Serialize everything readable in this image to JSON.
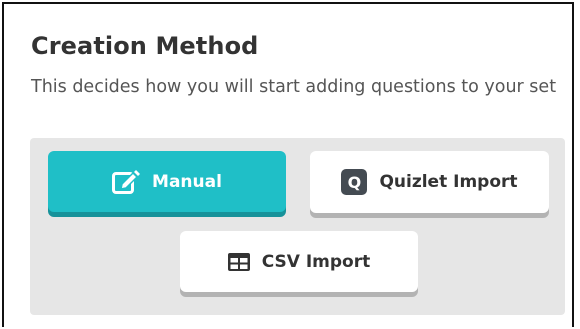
{
  "section": {
    "title": "Creation Method",
    "description": "This decides how you will start adding questions to your set"
  },
  "options": [
    {
      "label": "Manual",
      "icon": "edit-icon",
      "selected": true
    },
    {
      "label": "Quizlet Import",
      "icon": "quizlet-icon",
      "icon_text": "Q",
      "selected": false
    },
    {
      "label": "CSV Import",
      "icon": "table-icon",
      "selected": false
    }
  ],
  "colors": {
    "accent": "#1fbfc7",
    "accent_shadow": "#17929a",
    "panel_bg": "#e6e6e6",
    "button_bg": "#ffffff",
    "text": "#333333"
  }
}
